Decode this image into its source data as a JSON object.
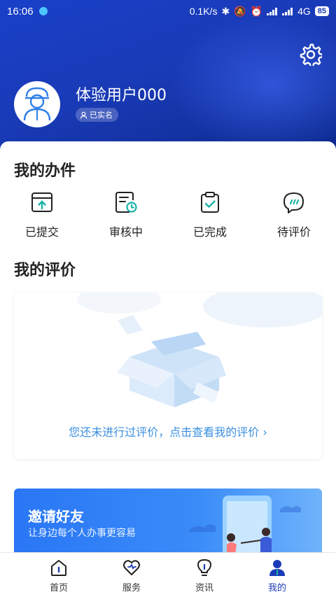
{
  "status_bar": {
    "time": "16:06",
    "network_speed": "0.1K/s",
    "network_type": "4G",
    "battery": "85"
  },
  "profile": {
    "username": "体验用户000",
    "verified_label": "已实名"
  },
  "my_tasks": {
    "title": "我的办件",
    "items": [
      {
        "label": "已提交",
        "icon": "submitted-icon"
      },
      {
        "label": "审核中",
        "icon": "reviewing-icon"
      },
      {
        "label": "已完成",
        "icon": "completed-icon"
      },
      {
        "label": "待评价",
        "icon": "pending-review-icon"
      }
    ]
  },
  "my_reviews": {
    "title": "我的评价",
    "empty_link": "您还未进行过评价，点击查看我的评价 ›"
  },
  "invite": {
    "title": "邀请好友",
    "subtitle": "让身边每个人办事更容易"
  },
  "tabbar": {
    "items": [
      {
        "label": "首页",
        "icon": "home-icon"
      },
      {
        "label": "服务",
        "icon": "heart-icon"
      },
      {
        "label": "资讯",
        "icon": "lightbulb-icon"
      },
      {
        "label": "我的",
        "icon": "user-icon"
      }
    ],
    "active_index": 3
  },
  "colors": {
    "brand": "#1a3bb8",
    "link": "#3b8fe0",
    "accent_teal": "#19b3a6"
  }
}
